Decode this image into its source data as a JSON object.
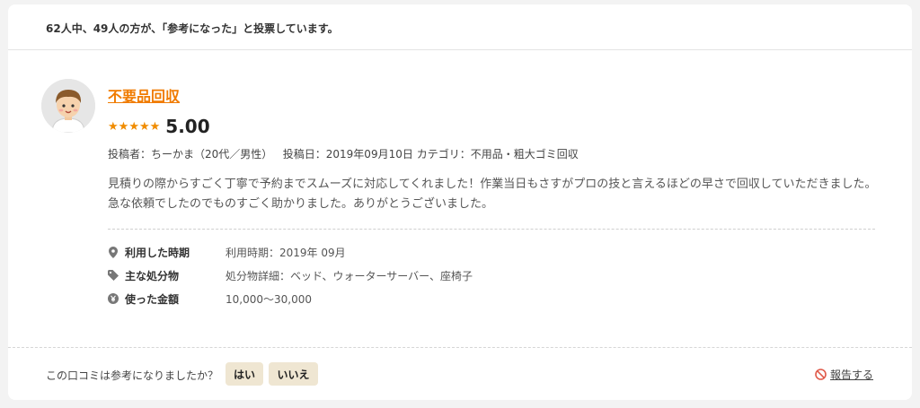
{
  "summary": {
    "text": "62人中、49人の方が、「参考になった」と投票しています。"
  },
  "review": {
    "title": "不要品回収",
    "stars": 5,
    "score": "5.00",
    "meta": {
      "poster": "投稿者：ちーかま（20代／男性）",
      "date": "投稿日：2019年09月10日",
      "category": "カテゴリ：不用品・粗大ゴミ回収"
    },
    "body": "見積りの際からすごく丁寧で予約までスムーズに対応してくれました！作業当日もさすがプロの技と言えるほどの早さで回収していただきました。急な依頼でしたのでものすごく助かりました。ありがとうございました。",
    "details": [
      {
        "icon": "location-pin-icon",
        "label": "利用した時期",
        "value": "利用時期：2019年 09月"
      },
      {
        "icon": "tag-icon",
        "label": "主な処分物",
        "value": "処分物詳細：ベッド、ウォーターサーバー、座椅子"
      },
      {
        "icon": "yen-icon",
        "label": "使った金額",
        "value": "10,000〜30,000"
      }
    ]
  },
  "feedback": {
    "question": "この口コミは参考になりましたか？",
    "yes_label": "はい",
    "no_label": "いいえ",
    "report_label": "報告する"
  },
  "colors": {
    "accent": "#f07b00",
    "star": "#f08c00",
    "vote_button": "#efe6d2",
    "report_icon": "#e05a4a"
  }
}
